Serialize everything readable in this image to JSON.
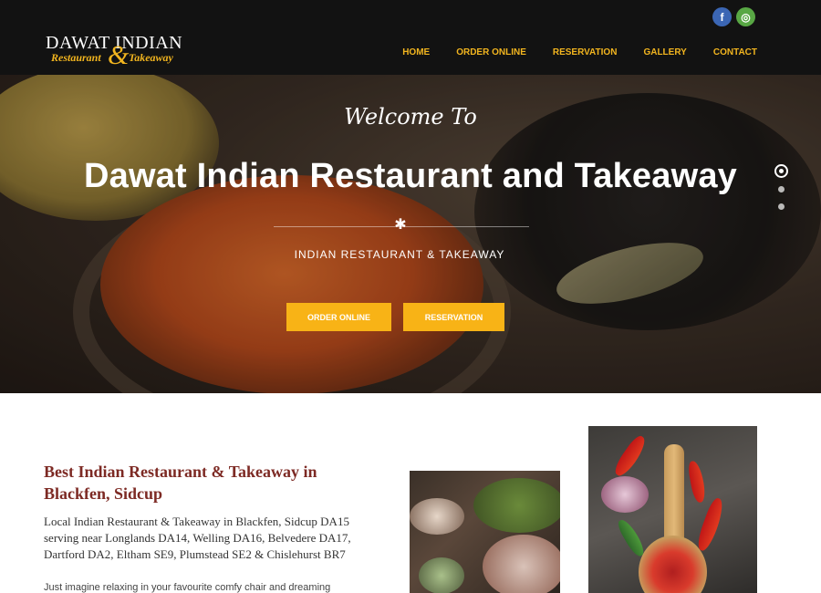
{
  "header": {
    "logo": {
      "name": "DAWAT INDIAN",
      "sub_left": "Restaurant",
      "ampersand": "&",
      "sub_right": "Takeaway"
    },
    "social": [
      {
        "name": "facebook",
        "glyph": "f",
        "color": "#3b66b4"
      },
      {
        "name": "tripadvisor",
        "glyph": "◎",
        "color": "#58a744"
      }
    ],
    "nav": [
      "HOME",
      "ORDER ONLINE",
      "RESERVATION",
      "GALLERY",
      "CONTACT"
    ],
    "accent": "#f2b51f"
  },
  "hero": {
    "script_line": "Welcome To",
    "title": "Dawat Indian Restaurant and Takeaway",
    "divider_icon": "flower-icon",
    "subtitle": "INDIAN RESTAURANT & TAKEAWAY",
    "buttons": [
      "ORDER ONLINE",
      "RESERVATION"
    ],
    "button_color": "#f8b316",
    "slides": 3,
    "active_slide": 1
  },
  "content": {
    "title": "Best Indian Restaurant & Takeaway in Blackfen, Sidcup",
    "intro": "Local Indian Restaurant & Takeaway in Blackfen, Sidcup DA15 serving near Longlands DA14, Welling DA16, Belvedere DA17, Dartford DA2, Eltham SE9, Plumstead SE2 & Chislehurst BR7",
    "body": "Just imagine relaxing in your favourite comfy chair and dreaming about",
    "title_color": "#7d2a24"
  }
}
